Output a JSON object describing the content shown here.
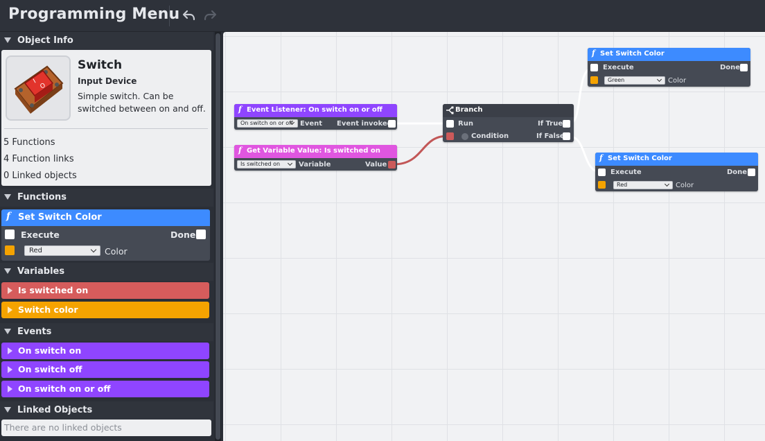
{
  "app": {
    "title": "Programming Menu"
  },
  "toolbar": {
    "undo_icon": "undo-icon",
    "redo_icon": "redo-icon"
  },
  "sidebar": {
    "object_info": {
      "header": "Object Info",
      "name": "Switch",
      "type": "Input Device",
      "description": "Simple switch. Can be switched between on and off.",
      "stats": [
        "5 Functions",
        "4 Function links",
        "0 Linked objects"
      ]
    },
    "functions": {
      "header": "Functions",
      "block": {
        "title": "Set Switch Color",
        "execute_label": "Execute",
        "done_label": "Done",
        "color_value": "Red",
        "color_label": "Color"
      }
    },
    "variables": {
      "header": "Variables",
      "items": [
        {
          "label": "Is switched on",
          "color": "#d65c5c"
        },
        {
          "label": "Switch color",
          "color": "#f5a300"
        }
      ]
    },
    "events": {
      "header": "Events",
      "items": [
        {
          "label": "On switch on",
          "color": "#8f45ff"
        },
        {
          "label": "On switch off",
          "color": "#8f45ff"
        },
        {
          "label": "On switch on or off",
          "color": "#8f45ff"
        }
      ]
    },
    "linked_objects": {
      "header": "Linked Objects",
      "empty_text": "There are no linked objects"
    }
  },
  "canvas": {
    "nodes": {
      "event_listener": {
        "title": "Event Listener: On switch on or off",
        "select_value": "On switch on or off",
        "select_label": "Event",
        "output_label": "Event invoked",
        "color": "#8f45ff"
      },
      "get_variable": {
        "title": "Get Variable Value: Is switched on",
        "select_value": "Is switched on",
        "select_label": "Variable",
        "output_label": "Value",
        "color": "#e056e0"
      },
      "branch": {
        "title": "Branch",
        "run_label": "Run",
        "condition_label": "Condition",
        "true_label": "If True",
        "false_label": "If False"
      },
      "set_color_green": {
        "title": "Set Switch Color",
        "execute_label": "Execute",
        "done_label": "Done",
        "color_value": "Green",
        "color_label": "Color",
        "color": "#3d8bff"
      },
      "set_color_red": {
        "title": "Set Switch Color",
        "execute_label": "Execute",
        "done_label": "Done",
        "color_value": "Red",
        "color_label": "Color",
        "color": "#3d8bff"
      }
    }
  }
}
